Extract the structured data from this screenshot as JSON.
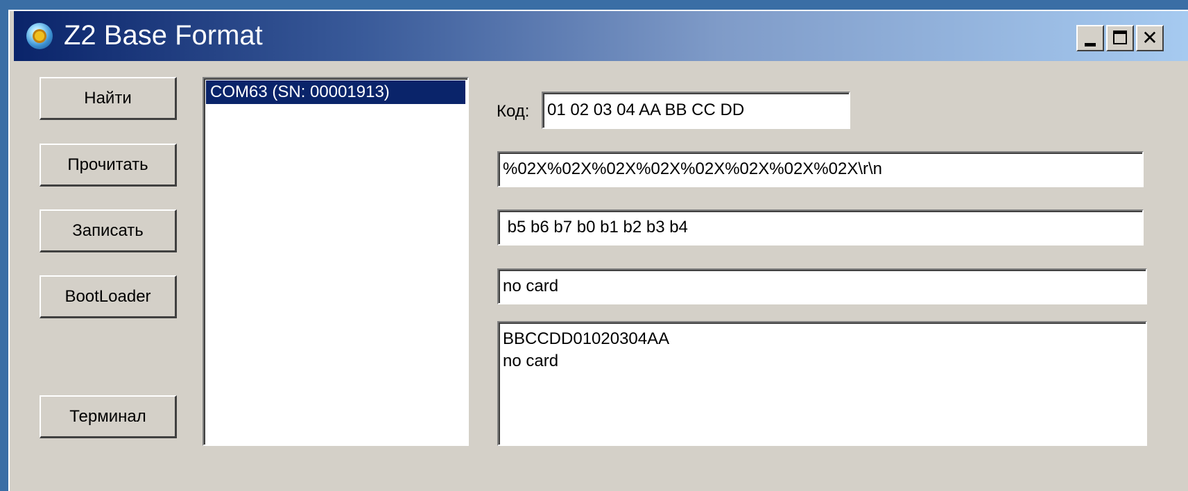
{
  "window": {
    "title": "Z2 Base Format",
    "icon": "app-globe-icon",
    "caption_buttons": {
      "minimize": "minimize-icon",
      "maximize": "maximize-icon",
      "close_glyph": "✕"
    }
  },
  "buttons": {
    "find": "Найти",
    "read": "Прочитать",
    "write": "Записать",
    "bootloader": "BootLoader",
    "terminal": "Терминал"
  },
  "port_list": {
    "items": [
      "COM63 (SN: 00001913)"
    ],
    "selected_index": 0
  },
  "code": {
    "label": "Код:",
    "value": "01 02 03 04 AA BB CC DD"
  },
  "format_string": "%02X%02X%02X%02X%02X%02X%02X%02X\\r\\n",
  "bit_order": " b5 b6 b7 b0 b1 b2 b3 b4",
  "status": "no card",
  "log": "BBCCDD01020304AA\nno card",
  "colors": {
    "titlebar_start": "#0a246a",
    "titlebar_end": "#a6caf0",
    "face": "#d4d0c8",
    "selection": "#0a246a",
    "desktop": "#3a6ea5"
  }
}
